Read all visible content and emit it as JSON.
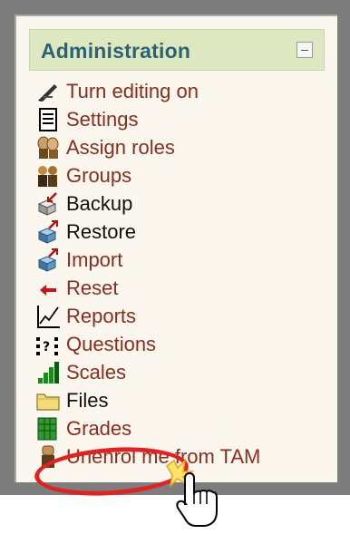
{
  "block": {
    "title": "Administration",
    "collapse_icon": "minus-box-icon"
  },
  "items": [
    {
      "label": "Turn editing on",
      "icon": "pencil-icon",
      "color": "#8b2d1a"
    },
    {
      "label": "Settings",
      "icon": "document-icon",
      "color": "#8b2d1a"
    },
    {
      "label": "Assign roles",
      "icon": "users-icon",
      "color": "#8b2d1a"
    },
    {
      "label": "Groups",
      "icon": "group-icon",
      "color": "#8b2d1a"
    },
    {
      "label": "Backup",
      "icon": "box-arrow-icon",
      "color": "#111111"
    },
    {
      "label": "Restore",
      "icon": "box-arrow-icon",
      "color": "#111111"
    },
    {
      "label": "Import",
      "icon": "box-arrow-icon",
      "color": "#8b2d1a"
    },
    {
      "label": "Reset",
      "icon": "red-arrow-icon",
      "color": "#8b2d1a"
    },
    {
      "label": "Reports",
      "icon": "line-chart-icon",
      "color": "#8b2d1a"
    },
    {
      "label": "Questions",
      "icon": "question-icon",
      "color": "#8b2d1a"
    },
    {
      "label": "Scales",
      "icon": "bar-chart-icon",
      "color": "#8b2d1a"
    },
    {
      "label": "Files",
      "icon": "folder-icon",
      "color": "#111111"
    },
    {
      "label": "Grades",
      "icon": "grades-icon",
      "color": "#8b2d1a"
    },
    {
      "label": "Unenrol me from TAM",
      "icon": "person-icon",
      "color": "#8b2d1a"
    }
  ],
  "colors": {
    "header_bg": "#dde7c0",
    "title": "#2b6376",
    "panel_bg": "#fbf7ef",
    "highlight": "#e42020"
  }
}
